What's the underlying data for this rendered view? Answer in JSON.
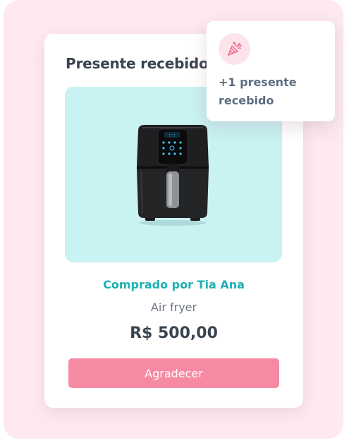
{
  "card": {
    "title": "Presente recebido",
    "product": {
      "image_icon": "air-fryer-image",
      "buyer_label": "Comprado por Tia Ana",
      "name": "Air fryer",
      "price": "R$ 500,00"
    },
    "thank_button_label": "Agradecer"
  },
  "notification": {
    "icon": "party-popper-icon",
    "text": "+1 presente recebido"
  },
  "colors": {
    "background": "#fde9ee",
    "product_background": "#c9f2f2",
    "accent_teal": "#1cb0b3",
    "button_pink": "#f78aa3",
    "icon_pink": "#f26b8a",
    "heading": "#3a4350"
  }
}
